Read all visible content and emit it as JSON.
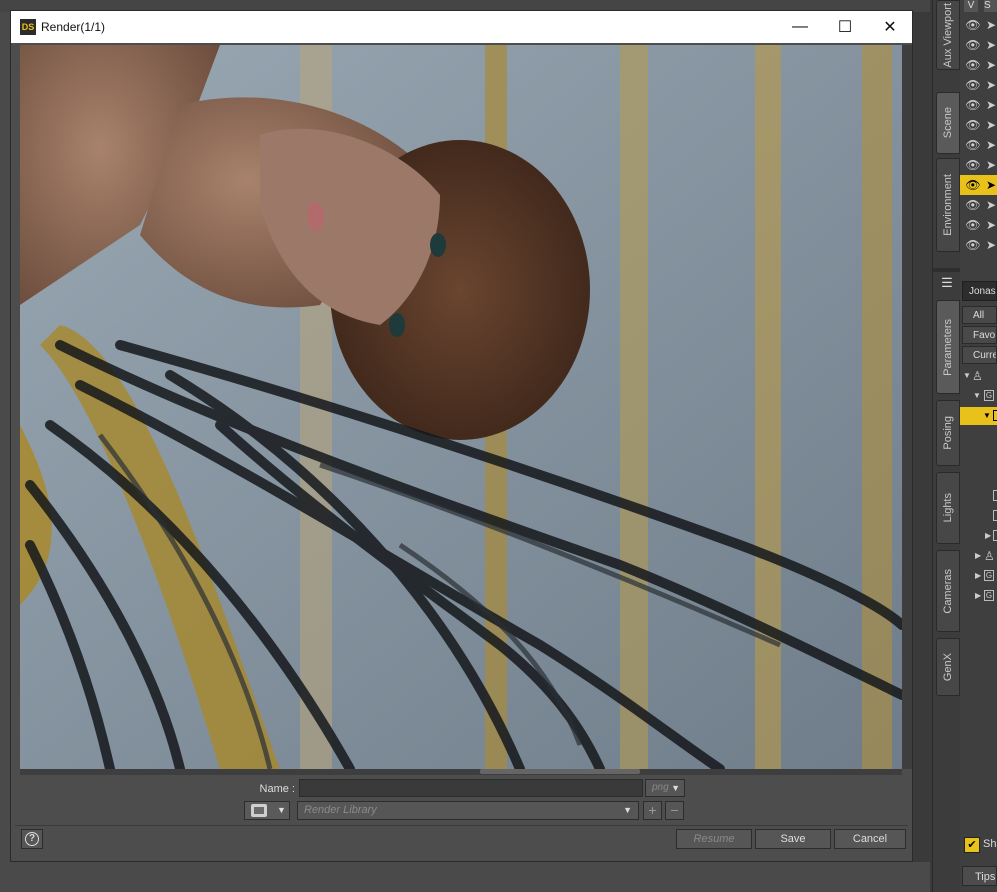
{
  "dialog": {
    "title": "Render(1/1)",
    "logo_text": "DS",
    "name_label": "Name :",
    "name_value": "",
    "format_value": "png",
    "library_placeholder": "Render Library",
    "add_label": "+",
    "remove_label": "−",
    "help_label": "?",
    "resume_label": "Resume",
    "save_label": "Save",
    "cancel_label": "Cancel",
    "minimize_glyph": "—",
    "maximize_glyph": "☐",
    "close_glyph": "✕"
  },
  "side_tabs": [
    "Aux Viewport",
    "Scene",
    "Environment",
    "Parameters",
    "Posing",
    "Lights",
    "Cameras",
    "GenX"
  ],
  "right_panel": {
    "header_v": "V",
    "header_s": "S",
    "name_field": "Jonas",
    "param_tabs": [
      "All",
      "Favo",
      "Curre"
    ],
    "show_label": "Sh",
    "tips_label": "Tips",
    "tree_labels": [
      "G",
      "[",
      "[",
      "[",
      "[",
      "G",
      "G"
    ]
  },
  "colors": {
    "accent": "#e8c21a",
    "dialog_bg": "#4d4d4d",
    "titlebar_bg": "#ffffff"
  }
}
